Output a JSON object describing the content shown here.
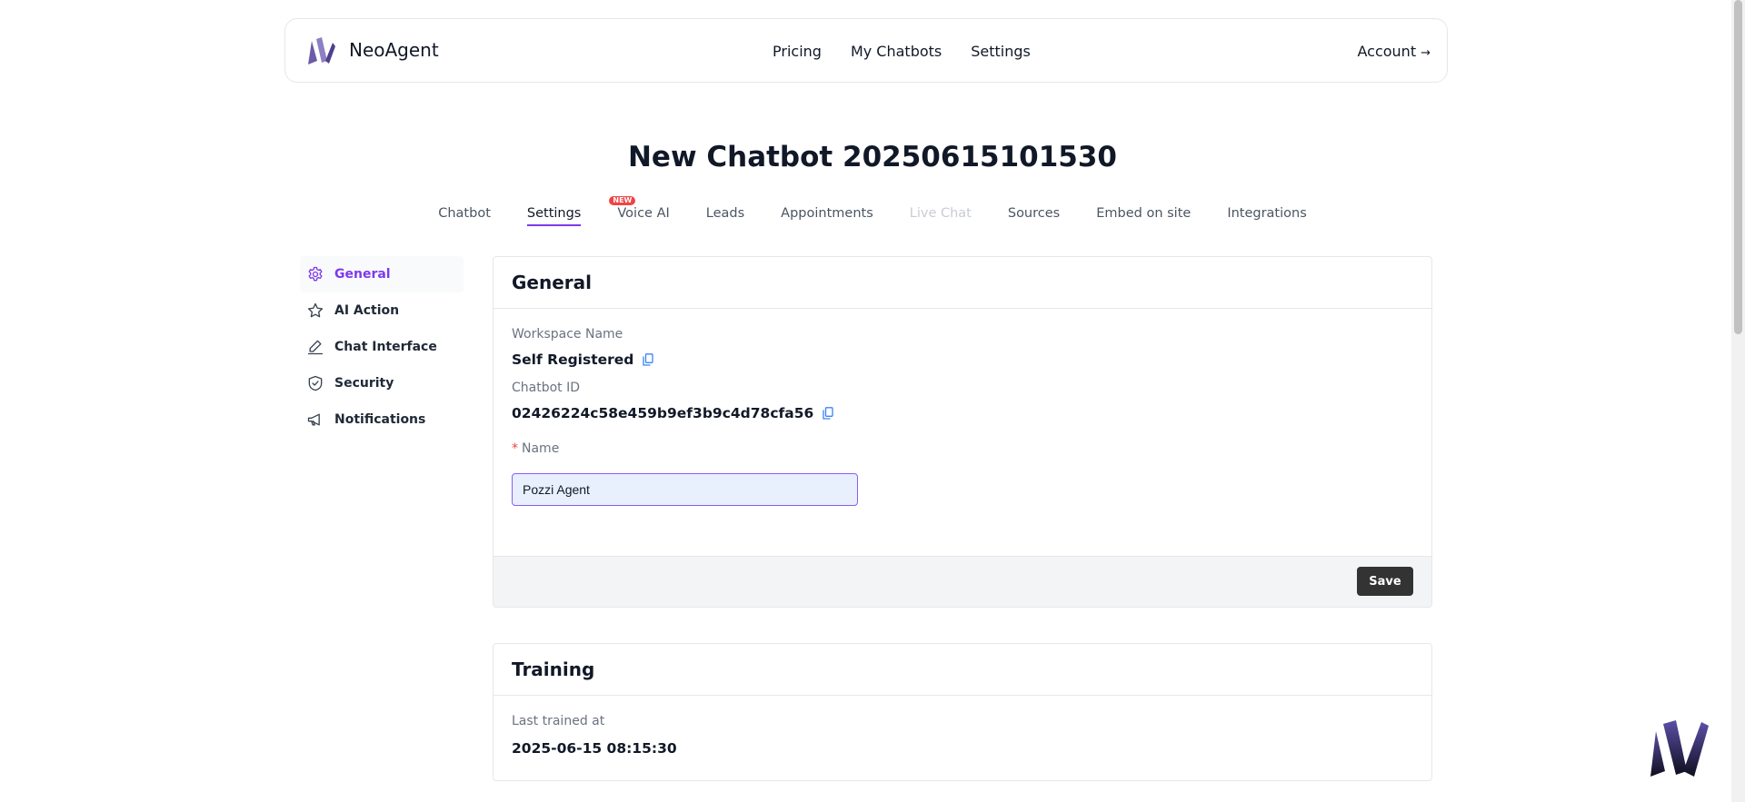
{
  "brand": {
    "name": "NeoAgent",
    "accent": "#7c3aed"
  },
  "topnav": {
    "items": [
      "Pricing",
      "My Chatbots",
      "Settings"
    ],
    "account": "Account",
    "account_arrow": "→"
  },
  "page": {
    "title": "New Chatbot 20250615101530"
  },
  "tabs": [
    {
      "label": "Chatbot",
      "state": "normal"
    },
    {
      "label": "Settings",
      "state": "active"
    },
    {
      "label": "Voice AI",
      "state": "normal",
      "badge": "NEW"
    },
    {
      "label": "Leads",
      "state": "normal"
    },
    {
      "label": "Appointments",
      "state": "normal"
    },
    {
      "label": "Live Chat",
      "state": "disabled"
    },
    {
      "label": "Sources",
      "state": "normal"
    },
    {
      "label": "Embed on site",
      "state": "normal"
    },
    {
      "label": "Integrations",
      "state": "normal"
    }
  ],
  "sidebar": {
    "items": [
      {
        "label": "General",
        "icon": "gear-icon",
        "active": true
      },
      {
        "label": "AI Action",
        "icon": "star-icon",
        "active": false
      },
      {
        "label": "Chat Interface",
        "icon": "pen-icon",
        "active": false
      },
      {
        "label": "Security",
        "icon": "shield-check-icon",
        "active": false
      },
      {
        "label": "Notifications",
        "icon": "megaphone-icon",
        "active": false
      }
    ]
  },
  "general": {
    "title": "General",
    "workspace_label": "Workspace Name",
    "workspace_value": "Self Registered",
    "chatbot_id_label": "Chatbot ID",
    "chatbot_id_value": "02426224c58e459b9ef3b9c4d78cfa56",
    "name_required_mark": "*",
    "name_label": "Name",
    "name_value": "Pozzi Agent",
    "save_label": "Save"
  },
  "training": {
    "title": "Training",
    "last_trained_label": "Last trained at",
    "last_trained_value": "2025-06-15 08:15:30"
  }
}
